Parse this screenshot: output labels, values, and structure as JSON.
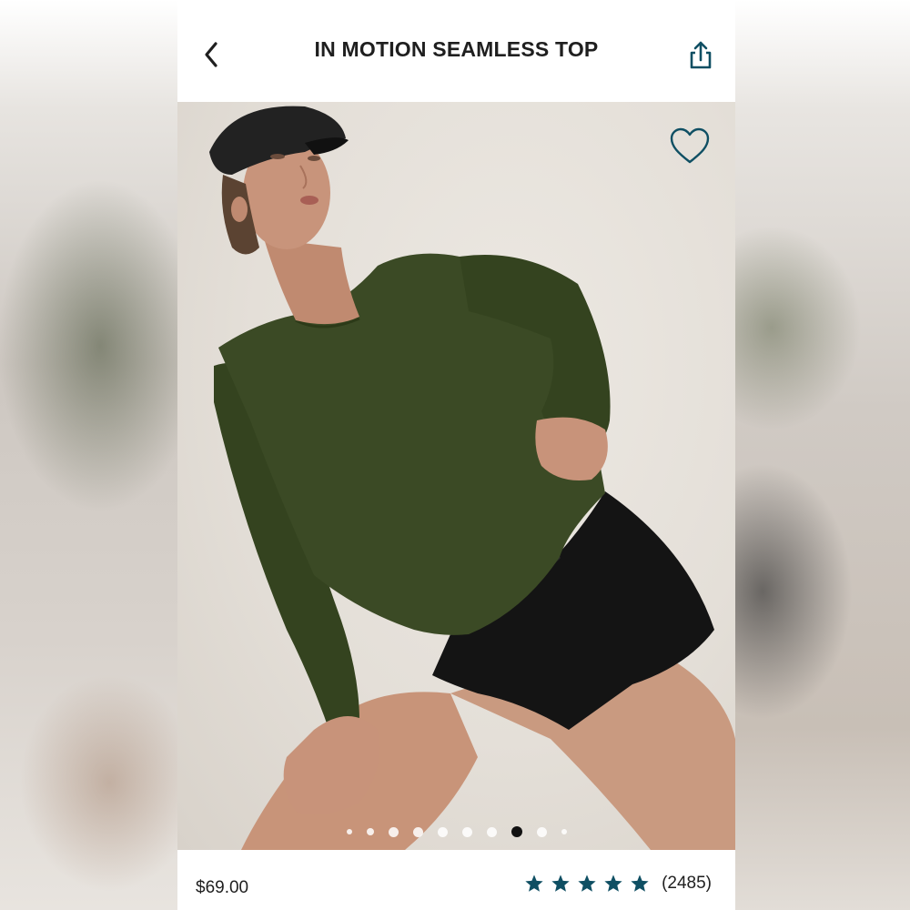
{
  "header": {
    "title": "IN MOTION SEAMLESS TOP"
  },
  "gallery": {
    "dot_count": 10,
    "active_index": 7
  },
  "product": {
    "price": "$69.00",
    "rating": 5,
    "review_count": "(2485)"
  },
  "colors": {
    "accent": "#0f4f63",
    "shirt": "#3b4a25",
    "shorts": "#141414"
  },
  "icons": {
    "back": "chevron-left-icon",
    "share": "share-icon",
    "favorite": "heart-outline-icon",
    "star": "star-icon"
  }
}
